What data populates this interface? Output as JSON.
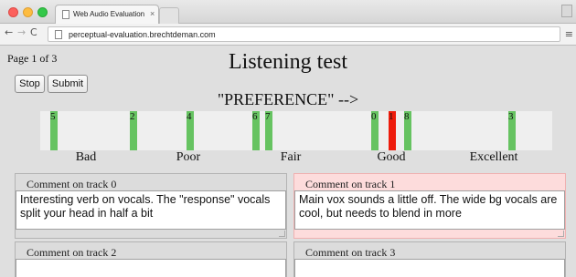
{
  "browser": {
    "tab_title": "Web Audio Evaluation T",
    "tab_audio_icon": "speaker-icon",
    "tab_close": "×",
    "url": "perceptual-evaluation.brechtdeman.com",
    "nav_back": "←",
    "nav_forward": "→",
    "nav_reload": "C",
    "menu": "≡"
  },
  "page": {
    "page_indicator": "Page 1 of 3",
    "title": "Listening test",
    "stop_label": "Stop",
    "submit_label": "Submit",
    "axis_title": "\"PREFERENCE\" -->",
    "scale_labels": [
      "Bad",
      "Poor",
      "Fair",
      "Good",
      "Excellent"
    ]
  },
  "markers": [
    {
      "label": "5",
      "value": 0.02,
      "active": false
    },
    {
      "label": "2",
      "value": 0.175,
      "active": false
    },
    {
      "label": "4",
      "value": 0.285,
      "active": false
    },
    {
      "label": "6",
      "value": 0.415,
      "active": false
    },
    {
      "label": "7",
      "value": 0.44,
      "active": false
    },
    {
      "label": "0",
      "value": 0.646,
      "active": false
    },
    {
      "label": "1",
      "value": 0.681,
      "active": true
    },
    {
      "label": "8",
      "value": 0.71,
      "active": false
    },
    {
      "label": "3",
      "value": 0.915,
      "active": false
    }
  ],
  "comments": [
    {
      "title": "Comment on track 0",
      "text": "Interesting verb on vocals. The \"response\" vocals split your head in half a bit"
    },
    {
      "title": "Comment on track 1",
      "text": "Main vox sounds a little off. The wide bg vocals are cool, but needs to blend in more"
    },
    {
      "title": "Comment on track 2",
      "text": ""
    },
    {
      "title": "Comment on track 3",
      "text": ""
    }
  ],
  "colors": {
    "marker_default": "#66c361",
    "marker_active": "#ee1c0c",
    "active_comment_bg": "#fddcdc"
  }
}
